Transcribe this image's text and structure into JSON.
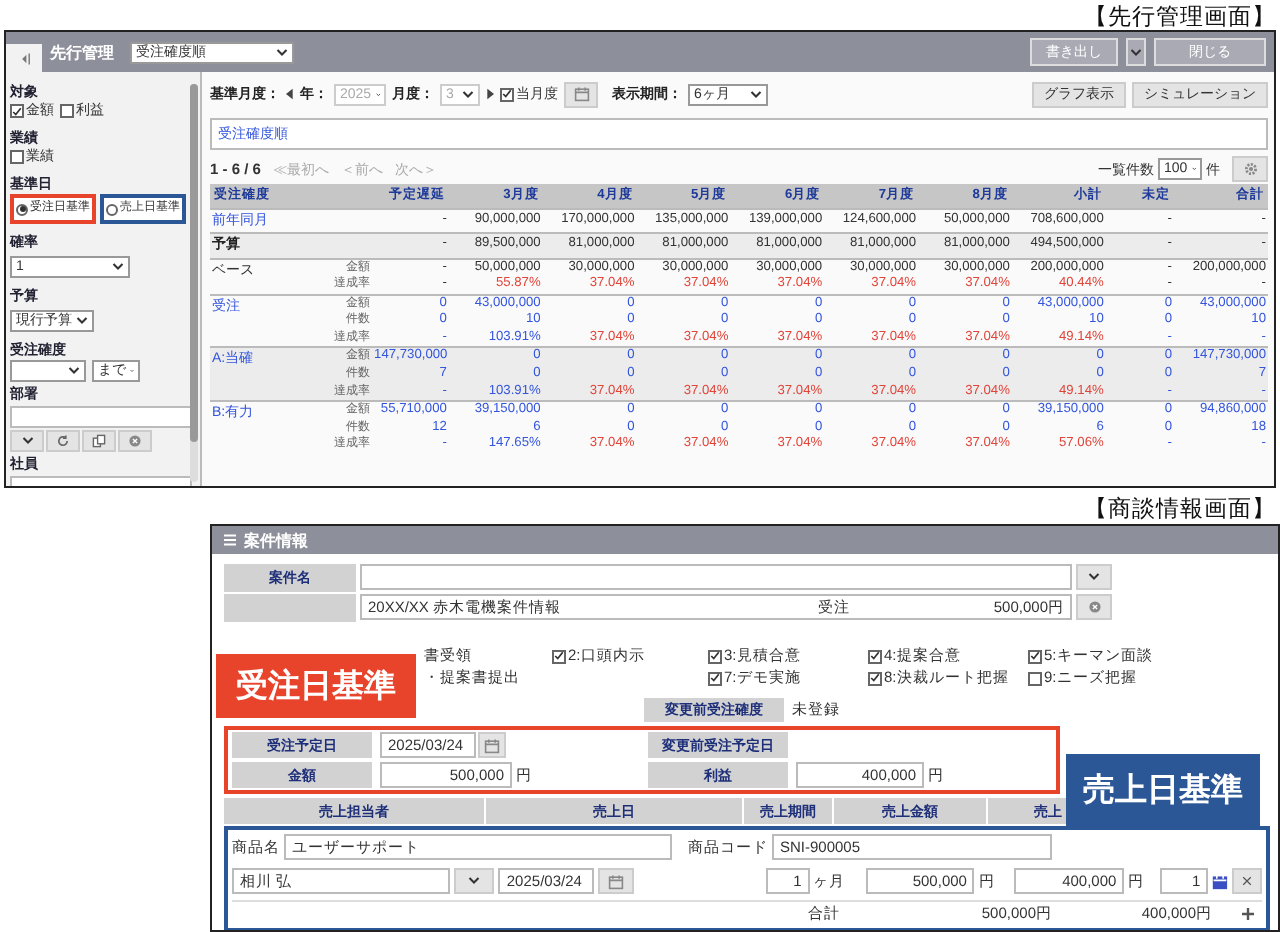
{
  "callouts": [
    {
      "label": "受注日基準",
      "color": "#e8442c"
    },
    {
      "label": "売上日基準",
      "color": "#2b5797"
    }
  ],
  "top_screen": {
    "caption": "【先行管理画面】",
    "window": {
      "title": "先行管理",
      "view_select": "受注確度順",
      "buttons": [
        "書き出し",
        "閉じる"
      ]
    },
    "sidebar": {
      "sections": [
        {
          "kind": "checks",
          "label": "対象",
          "options": [
            {
              "label": "金額",
              "checked": true
            },
            {
              "label": "利益",
              "checked": false
            }
          ]
        },
        {
          "kind": "checks",
          "label": "業績",
          "options": [
            {
              "label": "業績",
              "checked": false
            }
          ]
        },
        {
          "kind": "radios",
          "label": "基準日",
          "options": [
            {
              "label": "受注日基準",
              "selected": true
            },
            {
              "label": "売上日基準",
              "selected": false
            }
          ]
        },
        {
          "kind": "select",
          "label": "確率",
          "value": "1"
        },
        {
          "kind": "select",
          "label": "予算",
          "value": "現行予算"
        },
        {
          "kind": "range",
          "label": "受注確度",
          "until": "まで"
        },
        {
          "kind": "picker",
          "label": "部署"
        },
        {
          "kind": "picker",
          "label": "社員"
        }
      ]
    },
    "toolbar": {
      "base_month_label": "基準月度：",
      "year_label": "年：",
      "year": {
        "value": "2025",
        "disabled": true
      },
      "month_label": "月度：",
      "month": {
        "value": "3",
        "disabled": true
      },
      "current_month": {
        "label": "当月度",
        "checked": true
      },
      "period_label": "表示期間：",
      "period": "6ヶ月",
      "buttons": [
        "グラフ表示",
        "シミュレーション"
      ]
    },
    "sort_field": "受注確度順",
    "pager": {
      "range": "1 - 6 / 6",
      "links": [
        {
          "label": "≪最初へ",
          "disabled": true
        },
        {
          "label": "＜前へ",
          "disabled": true
        },
        {
          "label": "次へ＞",
          "disabled": true
        }
      ],
      "page_size_label": "一覧件数",
      "page_size": "100",
      "page_size_unit": "件"
    },
    "table": {
      "columns": [
        "受注確度",
        "予定遅延",
        "3月度",
        "4月度",
        "5月度",
        "6月度",
        "7月度",
        "8月度",
        "小計",
        "未定",
        "合計"
      ],
      "rows": [
        {
          "name": "前年同月",
          "kind": "reference",
          "shaded": false,
          "lines": [
            {
              "values": [
                "-",
                "90,000,000",
                "170,000,000",
                "135,000,000",
                "139,000,000",
                "124,600,000",
                "50,000,000",
                "708,600,000",
                "-",
                "-"
              ]
            }
          ]
        },
        {
          "name": "予算",
          "kind": "budget",
          "shaded": true,
          "lines": [
            {
              "values": [
                "-",
                "89,500,000",
                "81,000,000",
                "81,000,000",
                "81,000,000",
                "81,000,000",
                "81,000,000",
                "494,500,000",
                "-",
                "-"
              ]
            }
          ]
        },
        {
          "name": "ベース",
          "kind": "base",
          "shaded": false,
          "lines": [
            {
              "label": "金額",
              "values": [
                "-",
                "50,000,000",
                "30,000,000",
                "30,000,000",
                "30,000,000",
                "30,000,000",
                "30,000,000",
                "200,000,000",
                "-",
                "200,000,000"
              ]
            },
            {
              "label": "達成率",
              "values": [
                "-",
                "55.87%",
                "37.04%",
                "37.04%",
                "37.04%",
                "37.04%",
                "37.04%",
                "40.44%",
                "-",
                "-"
              ],
              "alert": [
                false,
                true,
                true,
                true,
                true,
                true,
                true,
                true,
                false,
                false
              ]
            }
          ]
        },
        {
          "name": "受注",
          "kind": "probability",
          "shaded": false,
          "lines": [
            {
              "label": "金額",
              "values": [
                "0",
                "43,000,000",
                "0",
                "0",
                "0",
                "0",
                "0",
                "43,000,000",
                "0",
                "43,000,000"
              ]
            },
            {
              "label": "件数",
              "values": [
                "0",
                "10",
                "0",
                "0",
                "0",
                "0",
                "0",
                "10",
                "0",
                "10"
              ]
            },
            {
              "label": "達成率",
              "values": [
                "-",
                "103.91%",
                "37.04%",
                "37.04%",
                "37.04%",
                "37.04%",
                "37.04%",
                "49.14%",
                "-",
                "-"
              ],
              "alert": [
                false,
                false,
                true,
                true,
                true,
                true,
                true,
                true,
                false,
                false
              ]
            }
          ]
        },
        {
          "name": "A:当確",
          "kind": "probability",
          "shaded": true,
          "lines": [
            {
              "label": "金額",
              "values": [
                "147,730,000",
                "0",
                "0",
                "0",
                "0",
                "0",
                "0",
                "0",
                "0",
                "147,730,000"
              ]
            },
            {
              "label": "件数",
              "values": [
                "7",
                "0",
                "0",
                "0",
                "0",
                "0",
                "0",
                "0",
                "0",
                "7"
              ]
            },
            {
              "label": "達成率",
              "values": [
                "-",
                "103.91%",
                "37.04%",
                "37.04%",
                "37.04%",
                "37.04%",
                "37.04%",
                "49.14%",
                "-",
                "-"
              ],
              "alert": [
                false,
                false,
                true,
                true,
                true,
                true,
                true,
                true,
                false,
                false
              ]
            }
          ]
        },
        {
          "name": "B:有力",
          "kind": "probability",
          "shaded": false,
          "lines": [
            {
              "label": "金額",
              "values": [
                "55,710,000",
                "39,150,000",
                "0",
                "0",
                "0",
                "0",
                "0",
                "39,150,000",
                "0",
                "94,860,000"
              ]
            },
            {
              "label": "件数",
              "values": [
                "12",
                "6",
                "0",
                "0",
                "0",
                "0",
                "0",
                "6",
                "0",
                "18"
              ]
            },
            {
              "label": "達成率",
              "values": [
                "-",
                "147.65%",
                "37.04%",
                "37.04%",
                "37.04%",
                "37.04%",
                "37.04%",
                "57.06%",
                "-",
                "-"
              ],
              "alert": [
                false,
                false,
                true,
                true,
                true,
                true,
                true,
                true,
                false,
                false
              ]
            }
          ]
        }
      ]
    }
  },
  "bottom_screen": {
    "caption": "【商談情報画面】",
    "window": {
      "title": "案件情報"
    },
    "deal_name": {
      "label": "案件名"
    },
    "linked_record": {
      "title": "20XX/XX 赤木電機案件情報",
      "status": "受注",
      "amount": "500,000円"
    },
    "checklist": [
      [
        {
          "kind": "partial",
          "label": "書受領"
        },
        {
          "kind": "check",
          "label": "2:口頭内示",
          "checked": true
        },
        {
          "kind": "check",
          "label": "3:見積合意",
          "checked": true
        },
        {
          "kind": "check",
          "label": "4:提案合意",
          "checked": true
        },
        {
          "kind": "check",
          "label": "5:キーマン面談",
          "checked": true
        }
      ],
      [
        {
          "kind": "partial",
          "label": "・提案書提出"
        },
        {
          "kind": "check",
          "label": "7:デモ実施",
          "checked": true
        },
        {
          "kind": "check",
          "label": "8:決裁ルート把握",
          "checked": true
        },
        {
          "kind": "check",
          "label": "9:ニーズ把握",
          "checked": false
        }
      ]
    ],
    "previous_probability": {
      "label": "変更前受注確度",
      "value": "未登録"
    },
    "order_date": {
      "label": "受注予定日",
      "value": "2025/03/24"
    },
    "previous_order_date": {
      "label": "変更前受注予定日"
    },
    "amount": {
      "label": "金額",
      "value": "500,000",
      "unit": "円"
    },
    "profit": {
      "label": "利益",
      "value": "400,000",
      "unit": "円"
    },
    "sales_table": {
      "columns": [
        "売上担当者",
        "売上日",
        "売上期間",
        "売上金額",
        "売上"
      ],
      "product": {
        "name_label": "商品名",
        "name": "ユーザーサポート",
        "code_label": "商品コード",
        "code": "SNI-900005"
      },
      "line": {
        "person": "相川 弘",
        "date": "2025/03/24",
        "period": "1",
        "period_unit": "ヶ月",
        "amount": "500,000",
        "amount_unit": "円",
        "profit": "400,000",
        "profit_unit": "円",
        "count": "1"
      },
      "total": {
        "label": "合計",
        "amount": "500,000円",
        "profit": "400,000円"
      }
    }
  }
}
